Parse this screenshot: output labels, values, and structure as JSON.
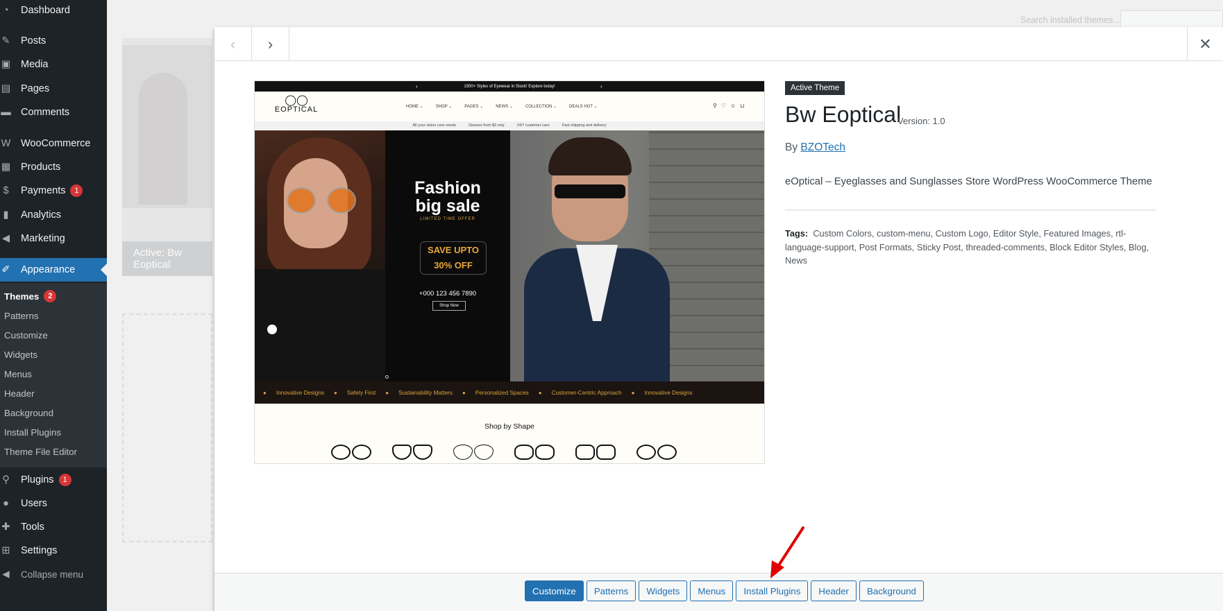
{
  "sidebar": {
    "items": [
      {
        "label": "Dashboard",
        "icon": "dashboard-icon"
      },
      {
        "label": "Posts",
        "icon": "pin-icon"
      },
      {
        "label": "Media",
        "icon": "media-icon"
      },
      {
        "label": "Pages",
        "icon": "pages-icon"
      },
      {
        "label": "Comments",
        "icon": "comment-icon"
      },
      {
        "label": "WooCommerce",
        "icon": "woocommerce-icon"
      },
      {
        "label": "Products",
        "icon": "products-icon"
      },
      {
        "label": "Payments",
        "icon": "payments-icon",
        "badge": "1"
      },
      {
        "label": "Analytics",
        "icon": "analytics-icon"
      },
      {
        "label": "Marketing",
        "icon": "megaphone-icon"
      },
      {
        "label": "Appearance",
        "icon": "paintbrush-icon"
      },
      {
        "label": "Plugins",
        "icon": "plug-icon",
        "badge": "1"
      },
      {
        "label": "Users",
        "icon": "users-icon"
      },
      {
        "label": "Tools",
        "icon": "wrench-icon"
      },
      {
        "label": "Settings",
        "icon": "settings-icon"
      },
      {
        "label": "Collapse menu",
        "icon": "collapse-icon"
      }
    ],
    "submenu": [
      {
        "label": "Themes",
        "badge": "2"
      },
      {
        "label": "Patterns"
      },
      {
        "label": "Customize"
      },
      {
        "label": "Widgets"
      },
      {
        "label": "Menus"
      },
      {
        "label": "Header"
      },
      {
        "label": "Background"
      },
      {
        "label": "Install Plugins"
      },
      {
        "label": "Theme File Editor"
      }
    ]
  },
  "background": {
    "search_placeholder": "Search installed themes...",
    "active_label": "Active: Bw Eoptical"
  },
  "preview": {
    "topbar": "1500+ Styles of Eyewear in Stock! Explore today!",
    "logo": "EOPTICAL",
    "nav": [
      "HOME ⌄",
      "SHOP ⌄",
      "PAGES ⌄",
      "NEWS ⌄",
      "COLLECTION ⌄",
      "DEALS HOT ⌄"
    ],
    "features": [
      "All your vision care needs",
      "Glasses from $9 only",
      "24/7 customer care",
      "Fast shipping and delivery"
    ],
    "hero": {
      "headline_1": "Fashion",
      "headline_2": "big sale",
      "tagline": "LIMITED TIME OFFER",
      "offer_1": "SAVE UPTO",
      "offer_2": "30% OFF",
      "phone": "+000 123 456 7890",
      "shop_now": "Shop Now"
    },
    "ticker": [
      "Innovative Designs",
      "Safety First",
      "Sustainability Matters",
      "Personalized Spaces",
      "Customer-Centric Approach",
      "Innovative Designs"
    ],
    "shape_title": "Shop by Shape"
  },
  "theme": {
    "badge": "Active Theme",
    "name": "Bw Eoptical",
    "version": "Version: 1.0",
    "by": "By",
    "author": "BZOTech",
    "description": "eOptical – Eyeglasses and Sunglasses Store WordPress WooCommerce Theme",
    "tags_label": "Tags:",
    "tags": "Custom Colors, custom-menu, Custom Logo, Editor Style, Featured Images, rtl-language-support, Post Formats, Sticky Post, threaded-comments, Block Editor Styles, Blog, News"
  },
  "footer": {
    "buttons": [
      "Customize",
      "Patterns",
      "Widgets",
      "Menus",
      "Install Plugins",
      "Header",
      "Background"
    ]
  },
  "colors": {
    "accent": "#2271b1",
    "sidebar": "#1d2327",
    "badge": "#d63638",
    "annotation_arrow": "#e00000"
  }
}
